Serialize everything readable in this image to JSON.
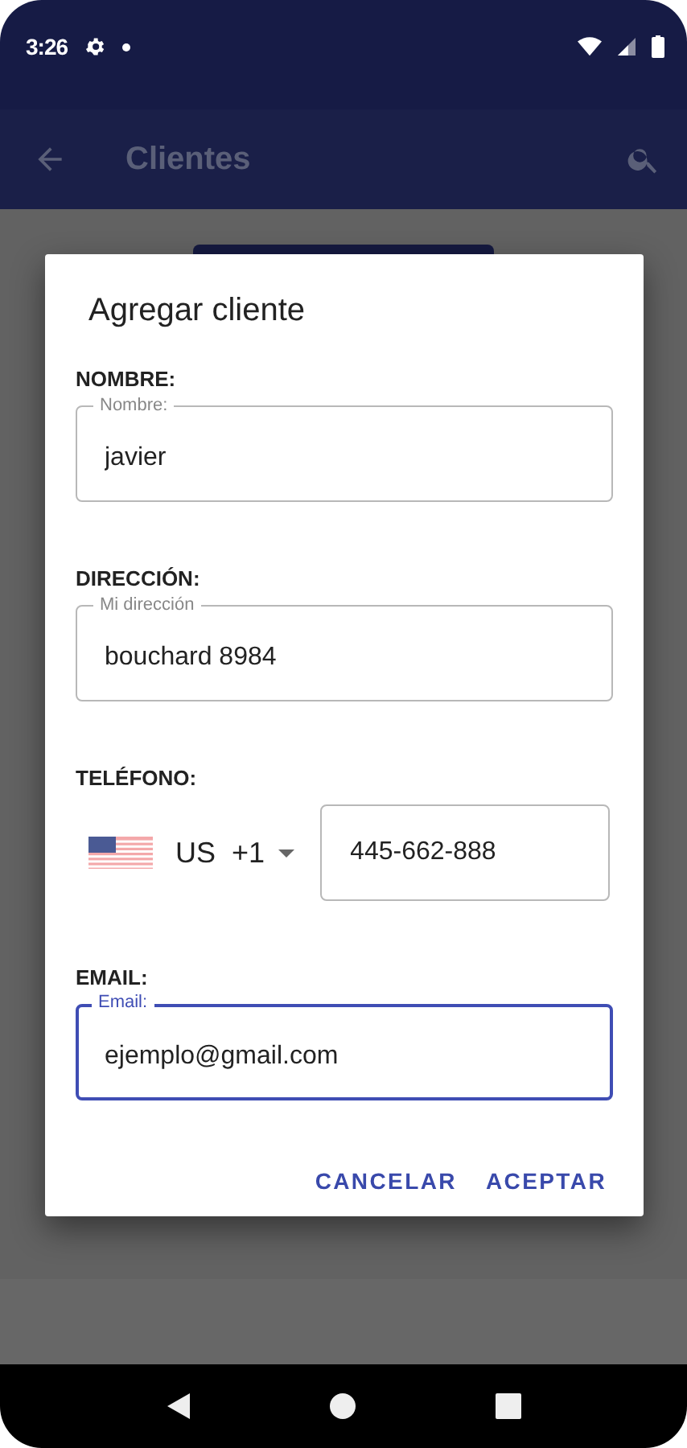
{
  "status_bar": {
    "time": "3:26"
  },
  "app_bar": {
    "title": "Clientes"
  },
  "dialog": {
    "title": "Agregar cliente",
    "fields": [
      {
        "kind": "text",
        "label": "NOMBRE:",
        "floating_label": "Nombre:",
        "value": "javier",
        "focused": false
      },
      {
        "kind": "text",
        "label": "DIRECCIÓN:",
        "floating_label": "Mi dirección",
        "value": "bouchard 8984",
        "focused": false
      },
      {
        "kind": "phone",
        "label": "TELÉFONO:",
        "country": "US",
        "dial_code": "+1",
        "value": "445-662-888",
        "focused": false
      },
      {
        "kind": "text",
        "label": "EMAIL:",
        "floating_label": "Email:",
        "value": "ejemplo@gmail.com",
        "focused": true
      }
    ],
    "actions": [
      "CANCELAR",
      "ACEPTAR"
    ]
  }
}
